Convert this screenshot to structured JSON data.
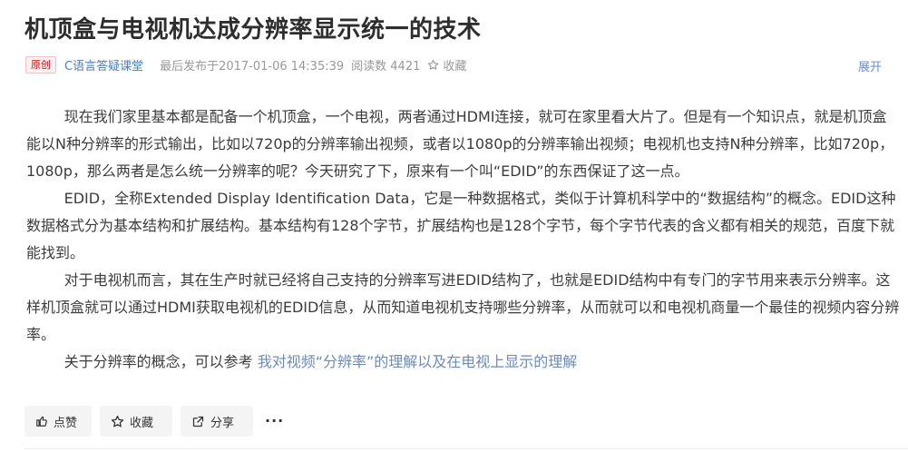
{
  "article": {
    "title": "机顶盒与电视机达成分辨率显示统一的技术",
    "badge": "原创",
    "author": "C语言答疑课堂",
    "published": "最后发布于2017-01-06 14:35:39",
    "reads": "阅读数 4421",
    "favorite": "收藏",
    "expand": "展开"
  },
  "content": {
    "p1": "现在我们家里基本都是配备一个机顶盒，一个电视，两者通过HDMI连接，就可在家里看大片了。但是有一个知识点，就是机顶盒能以N种分辨率的形式输出，比如以720p的分辨率输出视频，或者以1080p的分辨率输出视频；电视机也支持N种分辨率，比如720p，1080p，那么两者是怎么统一分辨率的呢？今天研究了下，原来有一个叫“EDID”的东西保证了这一点。",
    "p2": "EDID，全称Extended Display Identification Data，它是一种数据格式，类似于计算机科学中的“数据结构”的概念。EDID这种数据格式分为基本结构和扩展结构。基本结构有128个字节，扩展结构也是128个字节，每个字节代表的含义都有相关的规范，百度下就能找到。",
    "p3": "对于电视机而言，其在生产时就已经将自己支持的分辨率写进EDID结构了，也就是EDID结构中有专门的字节用来表示分辨率。这样机顶盒就可以通过HDMI获取电视机的EDID信息，从而知道电视机支持哪些分辨率，从而就可以和电视机商量一个最佳的视频内容分辨率。",
    "p4_prefix": "关于分辨率的概念，可以参考 ",
    "p4_link": "我对视频“分辨率”的理解以及在电视上显示的理解"
  },
  "toolbar": {
    "like": "点赞",
    "favorite": "收藏",
    "share": "分享",
    "more": "···"
  },
  "icons": {
    "like": "thumbs-up-icon",
    "favorite": "star-icon",
    "share": "share-icon"
  }
}
